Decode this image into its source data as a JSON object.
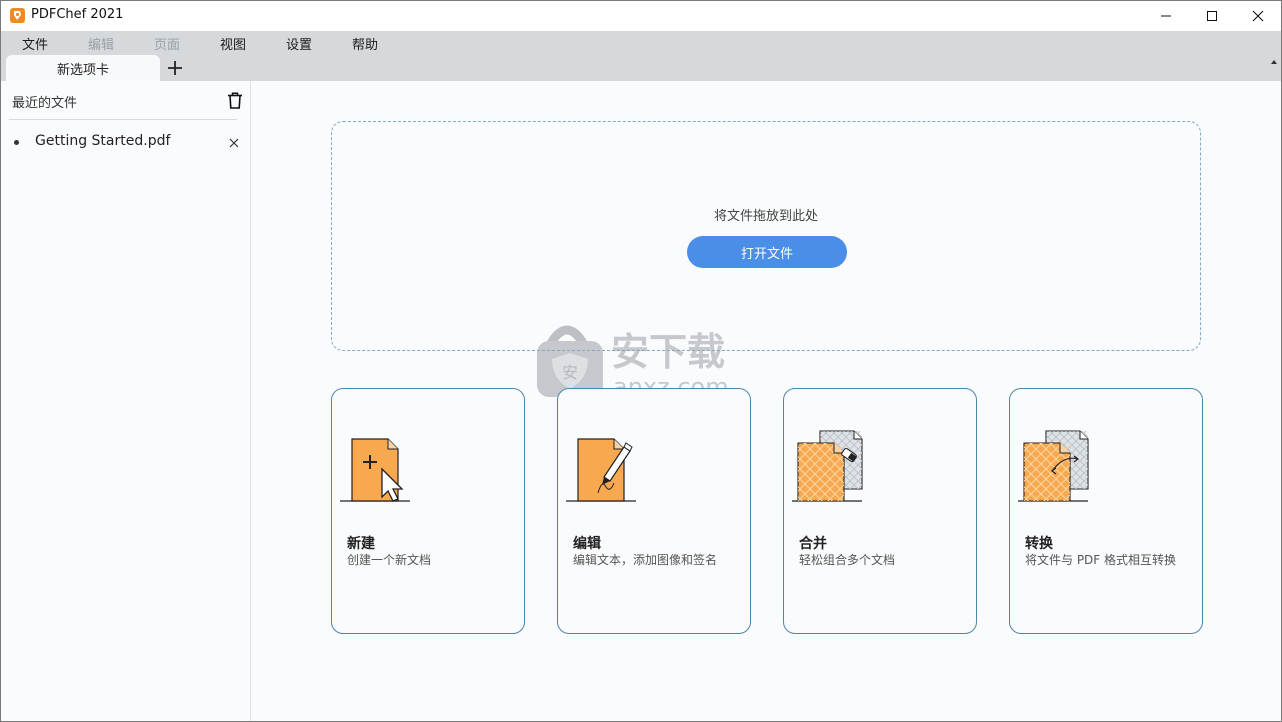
{
  "window": {
    "title": "PDFChef 2021"
  },
  "menu": [
    {
      "label": "文件",
      "enabled": true
    },
    {
      "label": "编辑",
      "enabled": false
    },
    {
      "label": "页面",
      "enabled": false
    },
    {
      "label": "视图",
      "enabled": true
    },
    {
      "label": "设置",
      "enabled": true
    },
    {
      "label": "帮助",
      "enabled": true
    }
  ],
  "tabs": [
    {
      "label": "新选项卡"
    }
  ],
  "sidebar": {
    "title": "最近的文件",
    "recent": [
      {
        "name": "Getting Started.pdf"
      }
    ]
  },
  "dropzone": {
    "text": "将文件拖放到此处",
    "button": "打开文件"
  },
  "watermark": {
    "text": "安下载",
    "domain": "anxz.com"
  },
  "cards": [
    {
      "title": "新建",
      "desc": "创建一个新文档",
      "icon": "new-document-icon"
    },
    {
      "title": "编辑",
      "desc": "编辑文本，添加图像和签名",
      "icon": "edit-document-icon"
    },
    {
      "title": "合并",
      "desc": "轻松组合多个文档",
      "icon": "merge-documents-icon"
    },
    {
      "title": "转换",
      "desc": "将文件与 PDF 格式相互转换",
      "icon": "convert-document-icon"
    }
  ],
  "colors": {
    "accent": "#4a8ee8",
    "card_border": "#4c86a8",
    "doc_orange": "#f8a94f",
    "chrome": "#d6d9dc"
  }
}
